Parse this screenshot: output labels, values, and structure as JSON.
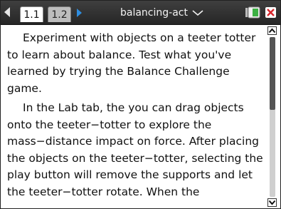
{
  "titlebar": {
    "tabs": [
      {
        "label": "1.1",
        "active": true
      },
      {
        "label": "1.2",
        "active": false
      }
    ],
    "document_title": "balancing-act",
    "icons": [
      "nav-back-icon",
      "nav-forward-icon",
      "chevron-down-icon",
      "battery-icon",
      "close-icon"
    ],
    "colors": {
      "bar": "#2b2b2b",
      "forward_arrow": "#2f8ee0",
      "battery_green": "#3cb043",
      "close_red": "#d9262c"
    }
  },
  "content": {
    "paragraphs": [
      "Experiment with objects on a teeter totter to learn about balance. Test what you've learned by trying the Balance Challenge game.",
      "In the Lab tab, the you can drag objects onto the teeter−totter to explore the mass−distance impact on force. After placing the objects on the teeter−totter, selecting the play button will remove the supports and let the teeter−totter rotate. When the"
    ]
  },
  "scrollbar": {
    "position_fraction": 0.0,
    "visible_fraction": 0.45
  }
}
